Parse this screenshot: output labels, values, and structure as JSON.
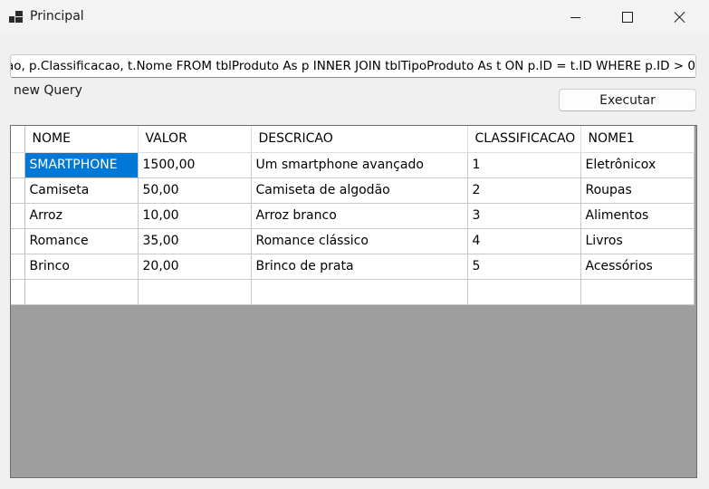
{
  "window": {
    "title": "Principal"
  },
  "query": {
    "value": "ao, p.Classificacao, t.Nome FROM tblProduto As p INNER JOIN tblTipoProduto As t ON p.ID = t.ID WHERE p.ID > 0",
    "label": "new Query"
  },
  "toolbar": {
    "execute_label": "Executar"
  },
  "grid": {
    "columns": [
      "NOME",
      "VALOR",
      "DESCRICAO",
      "CLASSIFICACAO",
      "NOME1"
    ],
    "rows": [
      [
        "SMARTPHONE",
        "1500,00",
        "Um smartphone avançado",
        "1",
        "Eletrônicox"
      ],
      [
        "Camiseta",
        "50,00",
        "Camiseta de algodão",
        "2",
        "Roupas"
      ],
      [
        "Arroz",
        "10,00",
        "Arroz branco",
        "3",
        "Alimentos"
      ],
      [
        "Romance",
        "35,00",
        "Romance clássico",
        "4",
        "Livros"
      ],
      [
        "Brinco",
        "20,00",
        "Brinco de prata",
        "5",
        "Acessórios"
      ]
    ],
    "selected_cell": "SMARTPHONE"
  },
  "colors": {
    "selection": "#0078d7",
    "grid_background": "#9e9e9e"
  }
}
